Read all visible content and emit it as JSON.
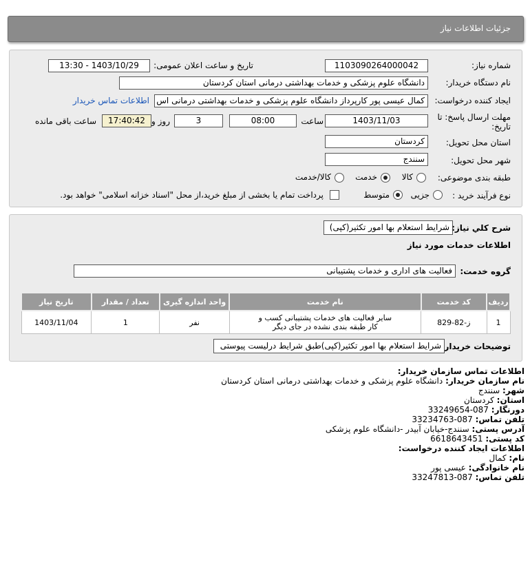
{
  "header": {
    "title": "جزئیات اطلاعات نیاز"
  },
  "form": {
    "need_number_label": "شماره نیاز:",
    "need_number": "1103090264000042",
    "announce_label": "تاریخ و ساعت اعلان عمومی:",
    "announce_value": "1403/10/29 - 13:30",
    "buyer_org_label": "نام دستگاه خریدار:",
    "buyer_org": "دانشگاه علوم پزشکی و خدمات بهداشتی  درمانی استان کردستان",
    "creator_label": "ایجاد کننده درخواست:",
    "creator": "کمال عیسی پور کارپرداز دانشگاه علوم پزشکی و خدمات بهداشتی  درمانی اس",
    "contact_link": "اطلاعات تماس خریدار",
    "deadline_label": "مهلت ارسال پاسخ: تا تاریخ:",
    "deadline_date": "1403/11/03",
    "time_label": "ساعت",
    "deadline_time": "08:00",
    "days_value": "3",
    "days_label": "روز و",
    "remaining_time": "17:40:42",
    "remaining_label": "ساعت باقی مانده",
    "province_label": "استان محل تحویل:",
    "province": "کردستان",
    "city_label": "شهر محل تحویل:",
    "city": "سنندج",
    "category_label": "طبقه بندی موضوعی:",
    "category_options": [
      "کالا",
      "خدمت",
      "کالا/خدمت"
    ],
    "category_selected": "خدمت",
    "process_label": "نوع فرآیند خرید :",
    "process_options": [
      "جزیی",
      "متوسط"
    ],
    "process_selected": "متوسط",
    "payment_note": "پرداخت تمام یا بخشی از مبلغ خرید،از محل \"اسناد خزانه اسلامی\" خواهد بود."
  },
  "details": {
    "summary_label": "شرح کلي نياز:",
    "summary": "شرایط استعلام بها امور تکثیر(کپی)",
    "services_title": "اطلاعات خدمات مورد نیاز",
    "service_group_label": "گروه خدمت:",
    "service_group": "فعالیت های اداری و خدمات پشتیبانی",
    "table": {
      "headers": [
        "ردیف",
        "کد خدمت",
        "نام خدمت",
        "واحد اندازه گیری",
        "تعداد / مقدار",
        "تاریخ نیاز"
      ],
      "rows": [
        [
          "1",
          "ز-82-829",
          "سایر فعالیت های خدمات پشتیبانی کسب و کار طبقه بندی نشده در جای دیگر",
          "نفر",
          "1",
          "1403/11/04"
        ]
      ]
    },
    "buyer_notes_label": "توضیحات خریدار:",
    "buyer_notes": "شرایط استعلام بها امور تکثیر(کپی)طبق شرایط درلیست پیوستی"
  },
  "contact": {
    "section_title": "اطلاعات تماس سازمان خریدار:",
    "org_label": "نام سازمان خریدار:",
    "org": "دانشگاه علوم پزشکی و خدمات بهداشتی درمانی استان کردستان",
    "city_label": "شهر:",
    "city": "سنندج",
    "province_label": "استان:",
    "province": "کردستان",
    "fax_label": "دورنگار:",
    "fax": "087-33249654",
    "phone_label": "تلفن تماس:",
    "phone": "087-33234763",
    "address_label": "آدرس پستی:",
    "address": "سنندج-خیابان آبیدر -دانشگاه علوم پزشکی",
    "postal_label": "کد پستی:",
    "postal": "6618643451",
    "creator_title": "اطلاعات ایجاد کننده درخواست:",
    "first_name_label": "نام:",
    "first_name": "کمال",
    "last_name_label": "نام خانوادگی:",
    "last_name": "عیسی پور",
    "creator_phone_label": "تلفن تماس:",
    "creator_phone": "087-33247813"
  }
}
